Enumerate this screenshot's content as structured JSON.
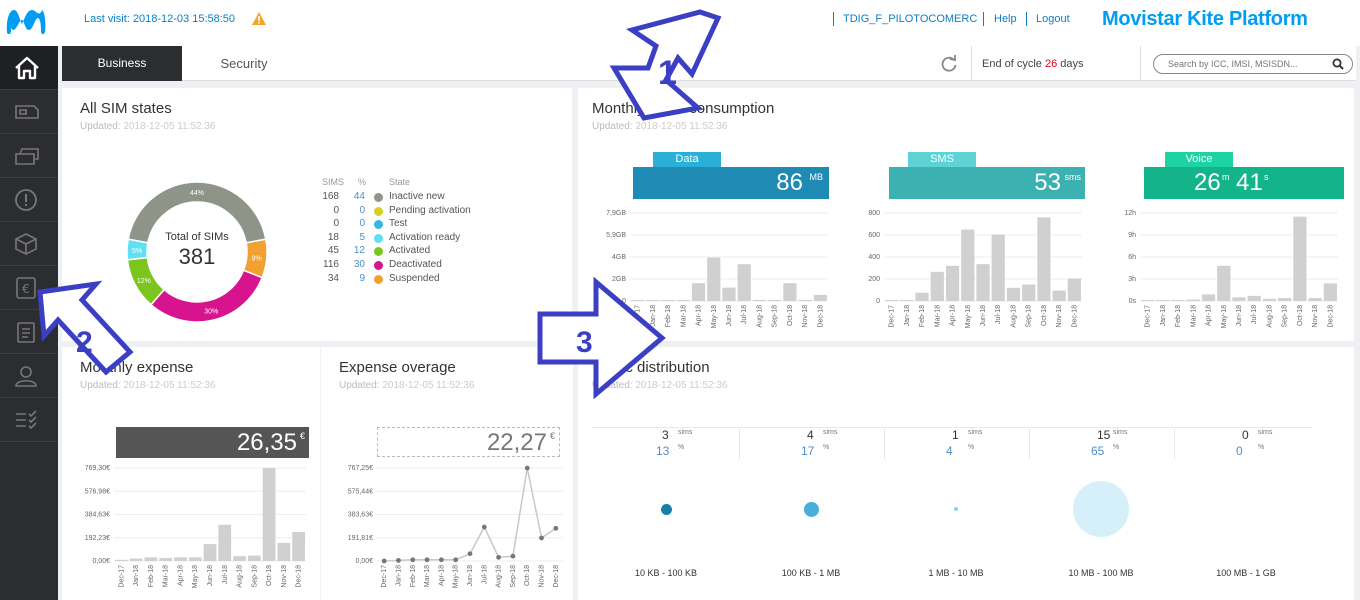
{
  "header": {
    "last_visit": "Last visit: 2018-12-03 15:58:50",
    "user": "TDIG_F_PILOTOCOMERC",
    "help": "Help",
    "logout": "Logout",
    "brand": "Movistar Kite Platform"
  },
  "sidebar": {
    "icons": [
      "home-icon",
      "sim-card-icon",
      "card-icon",
      "alert-icon",
      "box-icon",
      "euro-icon",
      "clipboard-icon",
      "user-icon",
      "checklist-icon"
    ]
  },
  "tabs": {
    "business": "Business",
    "security": "Security"
  },
  "cycle": {
    "prefix": "End of cycle ",
    "days": "26",
    "suffix": " days"
  },
  "search": {
    "placeholder": "Search by ICC, IMSI, MSISDN..."
  },
  "sim_states": {
    "title": "All SIM states",
    "updated_label": "Updated:",
    "updated": "2018-12-05 11:52:36",
    "total_label": "Total of SIMs",
    "total": "381",
    "col_sims": "SIMS",
    "col_pct": "%",
    "col_state": "State",
    "rows": [
      {
        "sims": "168",
        "pct": "44",
        "state": "Inactive new",
        "color": "#8e9488"
      },
      {
        "sims": "0",
        "pct": "0",
        "state": "Pending activation",
        "color": "#d6d11e"
      },
      {
        "sims": "0",
        "pct": "0",
        "state": "Test",
        "color": "#39b4e4"
      },
      {
        "sims": "18",
        "pct": "5",
        "state": "Activation ready",
        "color": "#5fe0f4"
      },
      {
        "sims": "45",
        "pct": "12",
        "state": "Activated",
        "color": "#7cc51e"
      },
      {
        "sims": "116",
        "pct": "30",
        "state": "Deactivated",
        "color": "#d7148d"
      },
      {
        "sims": "34",
        "pct": "9",
        "state": "Suspended",
        "color": "#f0a132"
      }
    ],
    "donut_labels": [
      "44%",
      "5%",
      "12%",
      "30%",
      "9%"
    ]
  },
  "traffic": {
    "title": "Monthly traffic consumption",
    "updated_label": "Updated:",
    "updated": "2018-12-05 11:52:36",
    "data": {
      "label": "Data",
      "value": "86",
      "unit": "MB",
      "tab_color": "#2ab0d8",
      "box_color": "#1f8ab4"
    },
    "sms": {
      "label": "SMS",
      "value": "53",
      "unit": "sms",
      "tab_color": "#5ed3d6",
      "box_color": "#3bb1b1"
    },
    "voice": {
      "label": "Voice",
      "value_m": "26",
      "unit_m": "m",
      "value_s": "41",
      "unit_s": "s",
      "tab_color": "#1ed3a3",
      "box_color": "#13b48a"
    },
    "months": [
      "Dec-17",
      "Jan-18",
      "Feb-18",
      "Mar-18",
      "Apr-18",
      "May-18",
      "Jun-18",
      "Jul-18",
      "Aug-18",
      "Sep-18",
      "Oct-18",
      "Nov-18",
      "Dec-18"
    ]
  },
  "expense": {
    "title": "Monthly expense",
    "updated_label": "Updated:",
    "updated": "2018-12-05 11:52:36",
    "value": "26,35",
    "unit": "€"
  },
  "overage": {
    "title": "Expense overage",
    "updated_label": "Updated:",
    "updated": "2018-12-05 11:52:36",
    "value": "22,27",
    "unit": "€"
  },
  "distribution": {
    "title": "Traffic distribution",
    "updated_label": "Updated:",
    "updated": "2018-12-05 11:52:36",
    "buckets": [
      {
        "sims": "3",
        "sims_unit": "sims",
        "pct": "13",
        "pct_unit": "%",
        "label": "10 KB - 100 KB"
      },
      {
        "sims": "4",
        "sims_unit": "sims",
        "pct": "17",
        "pct_unit": "%",
        "label": "100 KB - 1 MB"
      },
      {
        "sims": "1",
        "sims_unit": "sims",
        "pct": "4",
        "pct_unit": "%",
        "label": "1 MB - 10 MB"
      },
      {
        "sims": "15",
        "sims_unit": "sims",
        "pct": "65",
        "pct_unit": "%",
        "label": "10 MB - 100 MB"
      },
      {
        "sims": "0",
        "sims_unit": "sims",
        "pct": "0",
        "pct_unit": "%",
        "label": "100 MB - 1 GB"
      }
    ]
  },
  "annotations": {
    "a1": "1",
    "a2": "2",
    "a3": "3",
    "color": "#3b3fc4"
  },
  "chart_data": [
    {
      "type": "pie",
      "title": "All SIM states",
      "categories": [
        "Inactive new",
        "Activation ready",
        "Activated",
        "Deactivated",
        "Suspended"
      ],
      "values": [
        168,
        18,
        45,
        116,
        34
      ]
    },
    {
      "type": "bar",
      "title": "Data",
      "categories": [
        "Dec-17",
        "Jan-18",
        "Feb-18",
        "Mar-18",
        "Apr-18",
        "May-18",
        "Jun-18",
        "Jul-18",
        "Aug-18",
        "Sep-18",
        "Oct-18",
        "Nov-18",
        "Dec-18"
      ],
      "values": [
        0,
        0.05,
        0.05,
        0.1,
        1.6,
        3.9,
        1.2,
        3.3,
        0.1,
        0.1,
        1.6,
        0.1,
        0.55
      ],
      "yticks": [
        "0",
        "2GB",
        "4GB",
        "5,9GB",
        "7,9GB"
      ],
      "ylim": [
        0,
        7.9
      ]
    },
    {
      "type": "bar",
      "title": "SMS",
      "categories": [
        "Dec-17",
        "Jan-18",
        "Feb-18",
        "Mar-18",
        "Apr-18",
        "May-18",
        "Jun-18",
        "Jul-18",
        "Aug-18",
        "Sep-18",
        "Oct-18",
        "Nov-18",
        "Dec-18"
      ],
      "values": [
        0,
        5,
        75,
        265,
        320,
        650,
        335,
        605,
        120,
        150,
        760,
        95,
        205
      ],
      "yticks": [
        "0",
        "200",
        "400",
        "600",
        "800"
      ],
      "ylim": [
        0,
        800
      ]
    },
    {
      "type": "bar",
      "title": "Voice",
      "categories": [
        "Dec-17",
        "Jan-18",
        "Feb-18",
        "Mar-18",
        "Apr-18",
        "May-18",
        "Jun-18",
        "Jul-18",
        "Aug-18",
        "Sep-18",
        "Oct-18",
        "Nov-18",
        "Dec-18"
      ],
      "values": [
        0,
        0.1,
        0.1,
        0.2,
        0.9,
        4.8,
        0.5,
        0.7,
        0.3,
        0.4,
        11.5,
        0.4,
        2.4
      ],
      "yticks": [
        "0s",
        "3h",
        "6h",
        "9h",
        "12h"
      ],
      "ylim": [
        0,
        12
      ]
    },
    {
      "type": "bar",
      "title": "Monthly expense",
      "categories": [
        "Dec-17",
        "Jan-18",
        "Feb-18",
        "Mar-18",
        "Apr-18",
        "May-18",
        "Jun-18",
        "Jul-18",
        "Aug-18",
        "Sep-18",
        "Oct-18",
        "Nov-18",
        "Dec-18"
      ],
      "values": [
        10,
        20,
        30,
        25,
        30,
        30,
        140,
        300,
        40,
        45,
        769,
        150,
        240
      ],
      "yticks": [
        "0,00€",
        "192,23€",
        "384,63€",
        "576,98€",
        "769,30€"
      ],
      "ylim": [
        0,
        769.3
      ]
    },
    {
      "type": "line",
      "title": "Expense overage",
      "categories": [
        "Dec-17",
        "Jan-18",
        "Feb-18",
        "Mar-18",
        "Apr-18",
        "May-18",
        "Jun-18",
        "Jul-18",
        "Aug-18",
        "Sep-18",
        "Oct-18",
        "Nov-18",
        "Dec-18"
      ],
      "values": [
        0,
        5,
        10,
        10,
        10,
        10,
        60,
        280,
        30,
        40,
        767,
        190,
        270
      ],
      "yticks": [
        "0,00€",
        "191,81€",
        "383,63€",
        "575,44€",
        "767,25€"
      ],
      "ylim": [
        0,
        767.25
      ]
    },
    {
      "type": "scatter",
      "title": "Traffic distribution",
      "categories": [
        "10 KB - 100 KB",
        "100 KB - 1 MB",
        "1 MB - 10 MB",
        "10 MB - 100 MB",
        "100 MB - 1 GB"
      ],
      "values": [
        3,
        4,
        1,
        15,
        0
      ]
    }
  ]
}
